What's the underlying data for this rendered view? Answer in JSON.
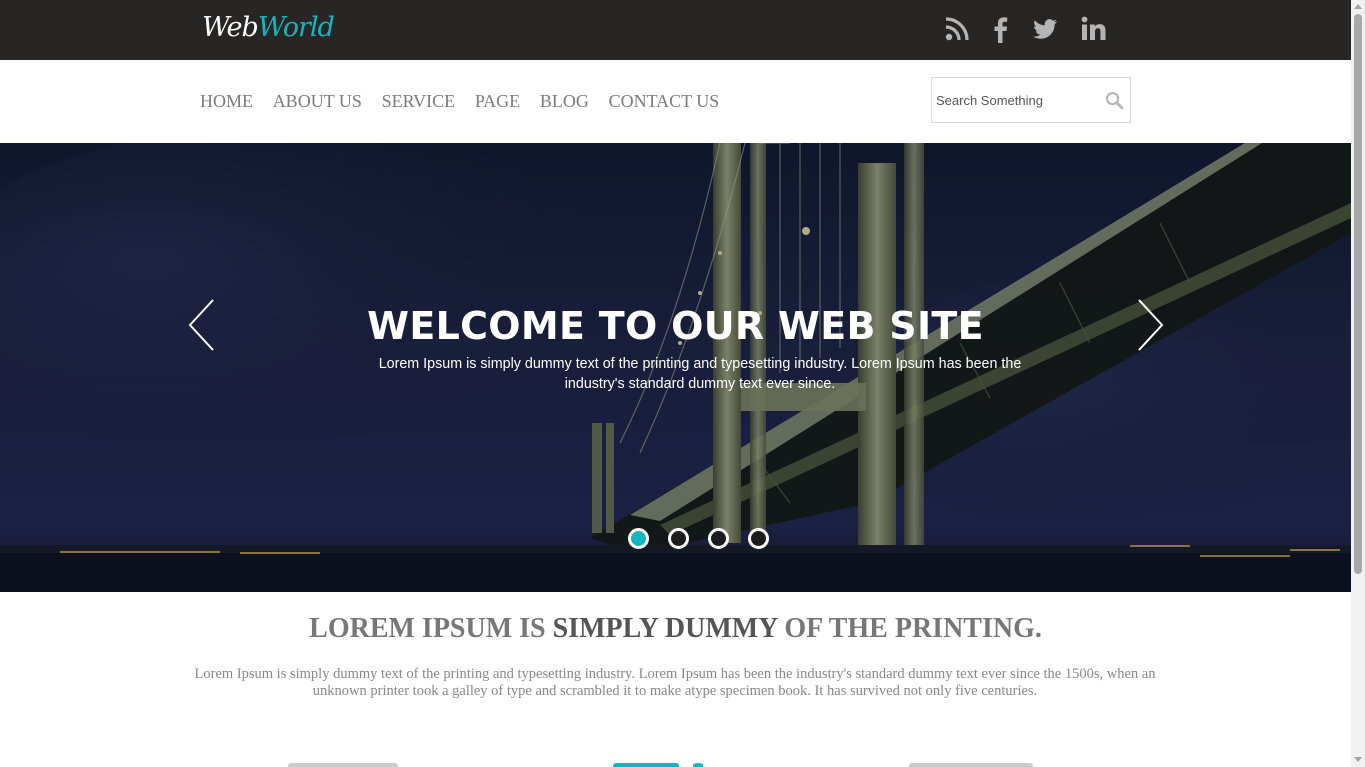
{
  "brand": {
    "part1": "Web",
    "part2": "World",
    "accent_color": "#14b4c1"
  },
  "social": [
    "rss-icon",
    "facebook-icon",
    "twitter-icon",
    "linkedin-icon"
  ],
  "nav": {
    "items": [
      {
        "label": "HOME"
      },
      {
        "label": "ABOUT US"
      },
      {
        "label": "SERVICE"
      },
      {
        "label": "PAGE"
      },
      {
        "label": "BLOG"
      },
      {
        "label": "CONTACT US"
      }
    ]
  },
  "search": {
    "placeholder": "Search Something",
    "value": ""
  },
  "hero": {
    "title": "WELCOME TO OUR WEB SITE",
    "subtitle": "Lorem Ipsum is simply dummy text of the printing and typesetting industry. Lorem Ipsum has been the industry's standard dummy text ever since.",
    "slide_count": 4,
    "active_slide": 1
  },
  "section": {
    "heading_part1": "LOREM IPSUM IS ",
    "heading_highlight": "SIMPLY DUMMY",
    "heading_part2": " OF THE PRINTING.",
    "paragraph": "Lorem Ipsum is simply dummy text of the printing and typesetting industry. Lorem Ipsum has been the industry's standard dummy text ever since the 1500s, when an unknown printer took a galley of type and scrambled it to make atype specimen book. It has survived not only five centuries."
  }
}
